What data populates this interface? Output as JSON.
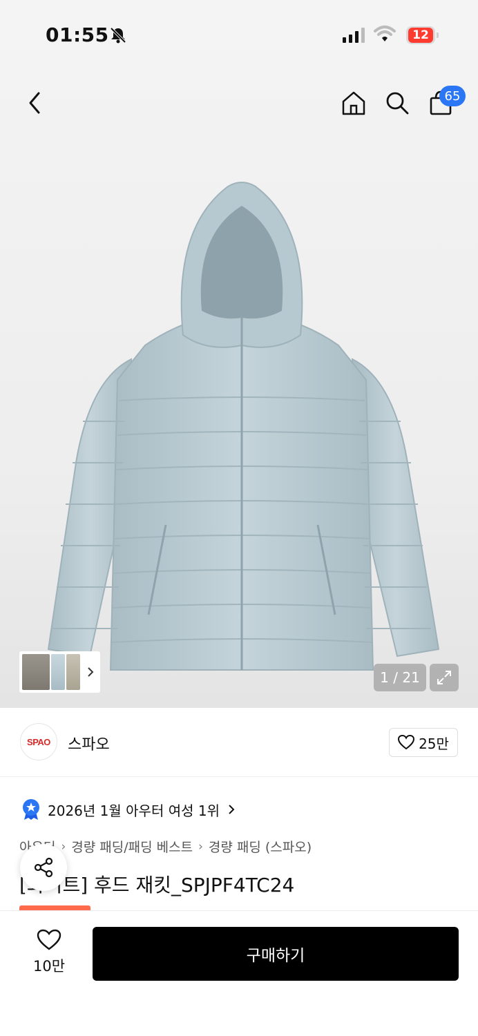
{
  "status": {
    "time": "01:55",
    "battery": "12"
  },
  "nav": {
    "cart_count": "65"
  },
  "gallery": {
    "counter": "1 / 21"
  },
  "brand": {
    "logo_text": "SPAO",
    "name": "스파오",
    "likes": "25만"
  },
  "rank": {
    "text": "2026년 1월 아우터 여성 1위"
  },
  "breadcrumb": [
    "아우터",
    "경량 패딩/패딩 베스트",
    "경량 패딩 (스파오)"
  ],
  "product": {
    "title": "[화이트] 후드 재킷_SPJPF4TC24"
  },
  "bottom": {
    "wish_count": "10만",
    "buy_label": "구매하기"
  },
  "colors": {
    "accent": "#2a76f5",
    "buy": "#000000",
    "tag": "#ff6b4a",
    "jacket": "#b9cbd2"
  }
}
